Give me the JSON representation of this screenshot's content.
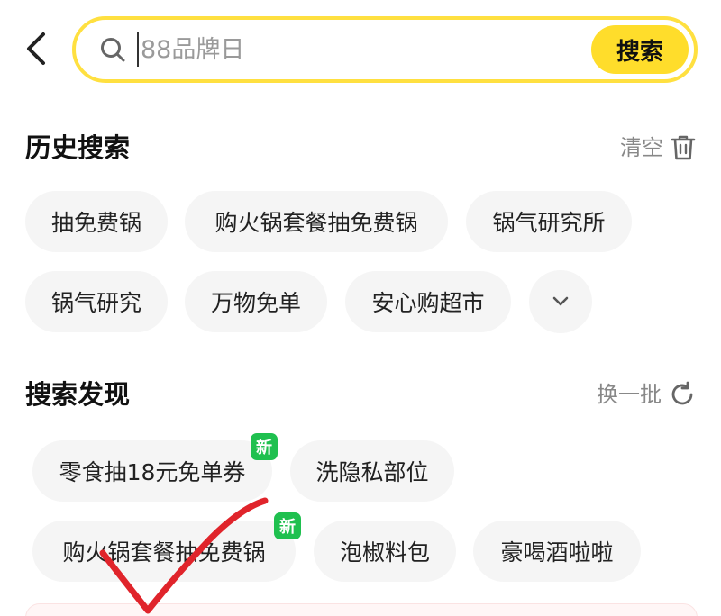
{
  "search": {
    "placeholder": "88品牌日",
    "button_label": "搜索"
  },
  "history": {
    "title": "历史搜索",
    "action_label": "清空",
    "items": [
      {
        "label": "抽免费锅"
      },
      {
        "label": "购火锅套餐抽免费锅"
      },
      {
        "label": "锅气研究所"
      },
      {
        "label": "锅气研究"
      },
      {
        "label": "万物免单"
      },
      {
        "label": "安心购超市"
      }
    ]
  },
  "discover": {
    "title": "搜索发现",
    "action_label": "换一批",
    "badge_label": "新",
    "items": [
      {
        "label": "零食抽18元免单券",
        "is_new": true
      },
      {
        "label": "洗隐私部位",
        "is_new": false
      },
      {
        "label": "购火锅套餐抽免费锅",
        "is_new": true
      },
      {
        "label": "泡椒料包",
        "is_new": false
      },
      {
        "label": "豪喝酒啦啦",
        "is_new": false
      }
    ]
  },
  "colors": {
    "accent": "#ffdd2b",
    "search_border": "#ffe040",
    "chip_bg": "#f5f5f5",
    "new_badge": "#1fc04f",
    "annotation": "#e0242b"
  },
  "icons": {
    "back": "chevron-left-icon",
    "search": "search-icon",
    "trash": "trash-icon",
    "expand": "chevron-down-icon",
    "refresh": "refresh-icon"
  }
}
